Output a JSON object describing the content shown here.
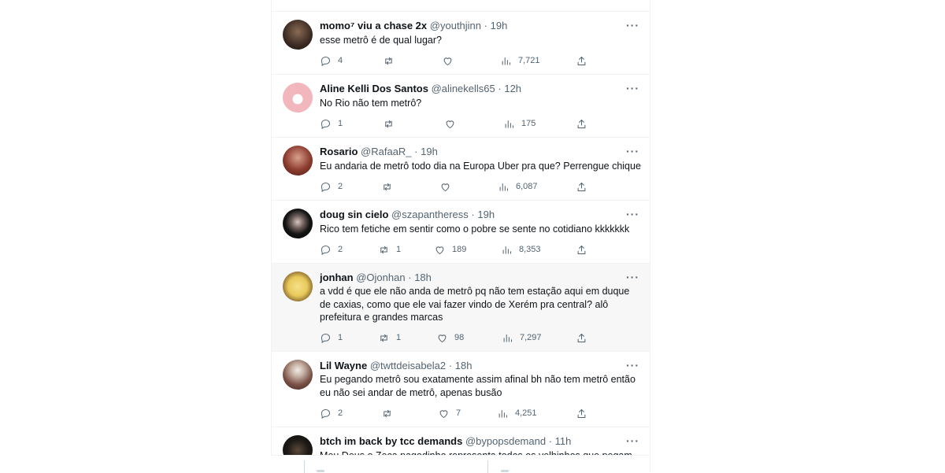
{
  "tweets": [
    {
      "name": "momo⁷ viu a chase 2x",
      "handle": "@youthjinn",
      "time": "19h",
      "text": "esse metrô é de qual lugar?",
      "replies": "4",
      "retweets": "",
      "likes": "",
      "views": "7,721"
    },
    {
      "name": "Aline Kelli Dos Santos",
      "handle": "@alinekells65",
      "time": "12h",
      "text": "No Rio não tem metrô?",
      "replies": "1",
      "retweets": "",
      "likes": "",
      "views": "175"
    },
    {
      "name": "Rosario",
      "handle": "@RafaaR_",
      "time": "19h",
      "text": "Eu andaria de metrô todo dia na Europa Uber pra que? Perrengue chique",
      "replies": "2",
      "retweets": "",
      "likes": "",
      "views": "6,087"
    },
    {
      "name": "doug sin cielo",
      "handle": "@szapantheress",
      "time": "19h",
      "text": "Rico tem fetiche em sentir como o pobre se sente no cotidiano kkkkkkk",
      "replies": "2",
      "retweets": "1",
      "likes": "189",
      "views": "8,353"
    },
    {
      "name": "jonhan",
      "handle": "@Ojonhan",
      "time": "18h",
      "text": "a vdd é que ele não anda de metrô pq não tem estação aqui em duque de caxias, como que ele vai fazer vindo de Xerém pra central? alô prefeitura e grandes marcas",
      "replies": "1",
      "retweets": "1",
      "likes": "98",
      "views": "7,297"
    },
    {
      "name": "Lil Wayne",
      "handle": "@twttdeisabela2",
      "time": "18h",
      "text": "Eu pegando metrô sou exatamente assim afinal bh não tem metrô então eu não sei andar de metrô, apenas busão",
      "replies": "2",
      "retweets": "",
      "likes": "7",
      "views": "4,251"
    },
    {
      "name": "btch im back by tcc demands",
      "handle": "@bypopsdemand",
      "time": "11h",
      "text": "Meu Deus o Zeca pagodinho representa todos os velhinhos que pegam",
      "replies": "",
      "retweets": "",
      "likes": "",
      "views": ""
    }
  ],
  "dot": "·",
  "colors": {
    "text": "#0f1419",
    "secondary": "#536471",
    "divider": "#eff3f4"
  },
  "icons": [
    "reply-icon",
    "retweet-icon",
    "like-icon",
    "views-icon",
    "share-icon",
    "more-icon"
  ]
}
